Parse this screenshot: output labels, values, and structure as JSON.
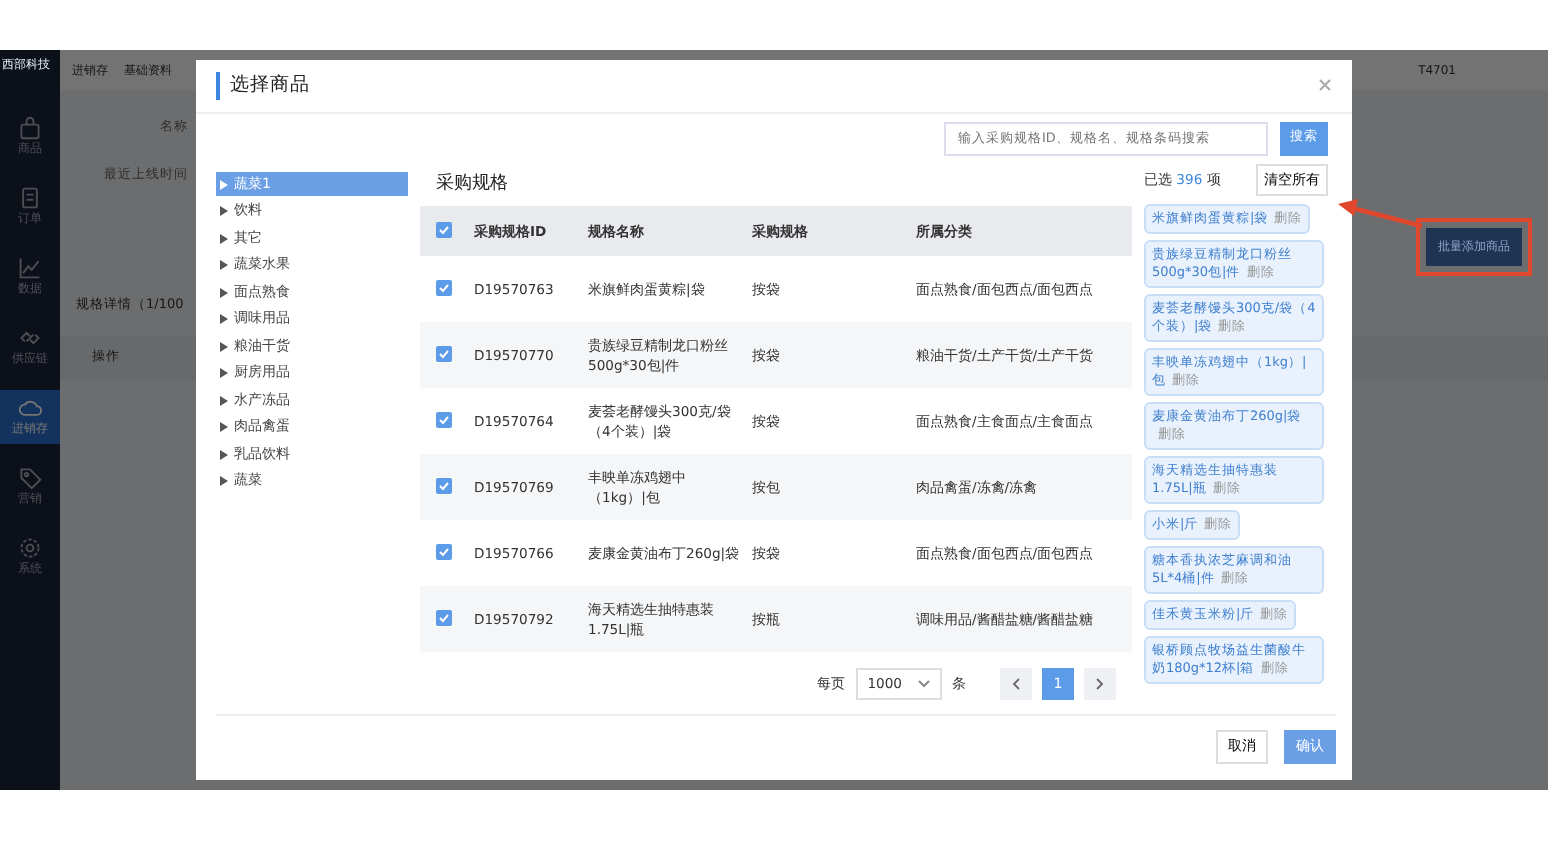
{
  "app": {
    "logo": "西部科技",
    "breadcrumb": [
      "进销存",
      "基础资料"
    ],
    "account": "T4701",
    "sidebar": [
      {
        "label": "商品",
        "selected": false
      },
      {
        "label": "订单",
        "selected": false
      },
      {
        "label": "数据",
        "selected": false
      },
      {
        "label": "供应链",
        "selected": false
      },
      {
        "label": "进销存",
        "selected": true
      },
      {
        "label": "营销",
        "selected": false
      },
      {
        "label": "系统",
        "selected": false
      }
    ],
    "form_labels": [
      "名称",
      "最近上线时间"
    ],
    "section_title": "规格详情（1/100",
    "table_header": "操作",
    "batch_add_button": "批量添加商品"
  },
  "modal": {
    "title": "选择商品",
    "search": {
      "placeholder": "输入采购规格ID、规格名、规格条码搜索",
      "button": "搜索"
    },
    "tree": [
      {
        "label": "蔬菜1",
        "selected": true
      },
      {
        "label": "饮料",
        "selected": false
      },
      {
        "label": "其它",
        "selected": false
      },
      {
        "label": "蔬菜水果",
        "selected": false
      },
      {
        "label": "面点熟食",
        "selected": false
      },
      {
        "label": "调味用品",
        "selected": false
      },
      {
        "label": "粮油干货",
        "selected": false
      },
      {
        "label": "厨房用品",
        "selected": false
      },
      {
        "label": "水产冻品",
        "selected": false
      },
      {
        "label": "肉品禽蛋",
        "selected": false
      },
      {
        "label": "乳品饮料",
        "selected": false
      },
      {
        "label": "蔬菜",
        "selected": false
      }
    ],
    "table": {
      "title": "采购规格",
      "all_checked": true,
      "columns": [
        "采购规格ID",
        "规格名称",
        "采购规格",
        "所属分类"
      ],
      "rows": [
        {
          "checked": true,
          "cells": [
            "D19570763",
            "米旗鲜肉蛋黄粽|袋",
            "按袋",
            "面点熟食/面包西点/面包西点"
          ]
        },
        {
          "checked": true,
          "cells": [
            "D19570770",
            "贵族绿豆精制龙口粉丝500g*30包|件",
            "按袋",
            "粮油干货/土产干货/土产干货"
          ]
        },
        {
          "checked": true,
          "cells": [
            "D19570764",
            "麦荟老酵馒头300克/袋（4个装）|袋",
            "按袋",
            "面点熟食/主食面点/主食面点"
          ]
        },
        {
          "checked": true,
          "cells": [
            "D19570769",
            "丰映单冻鸡翅中（1kg）|包",
            "按包",
            "肉品禽蛋/冻禽/冻禽"
          ]
        },
        {
          "checked": true,
          "cells": [
            "D19570766",
            "麦康金黄油布丁260g|袋",
            "按袋",
            "面点熟食/面包西点/面包西点"
          ]
        },
        {
          "checked": true,
          "cells": [
            "D19570792",
            "海天精选生抽特惠装1.75L|瓶",
            "按瓶",
            "调味用品/酱醋盐糖/酱醋盐糖"
          ]
        }
      ]
    },
    "pagination": {
      "per_page_label": "每页",
      "page_size": "1000",
      "unit": "条",
      "pages": [
        {
          "label": "1",
          "selected": true
        }
      ]
    },
    "selection": {
      "prefix": "已选",
      "count": "396",
      "suffix": "项",
      "clear_button": "清空所有",
      "items": [
        {
          "label": "米旗鲜肉蛋黄粽|袋",
          "remove": "删除"
        },
        {
          "label": "贵族绿豆精制龙口粉丝500g*30包|件",
          "remove": "删除"
        },
        {
          "label": "麦荟老酵馒头300克/袋（4个装）|袋",
          "remove": "删除"
        },
        {
          "label": "丰映单冻鸡翅中（1kg）|包",
          "remove": "删除"
        },
        {
          "label": "麦康金黄油布丁260g|袋",
          "remove": "删除"
        },
        {
          "label": "海天精选生抽特惠装1.75L|瓶",
          "remove": "删除"
        },
        {
          "label": "小米|斤",
          "remove": "删除"
        },
        {
          "label": "糖本香执浓芝麻调和油5L*4桶|件",
          "remove": "删除"
        },
        {
          "label": "佳禾黄玉米粉|斤",
          "remove": "删除"
        },
        {
          "label": "银桥顾点牧场益生菌酸牛奶180g*12杯|箱",
          "remove": "删除"
        }
      ]
    },
    "buttons": [
      {
        "label": "取消",
        "kind": "secondary"
      },
      {
        "label": "确认",
        "kind": "primary"
      }
    ]
  }
}
